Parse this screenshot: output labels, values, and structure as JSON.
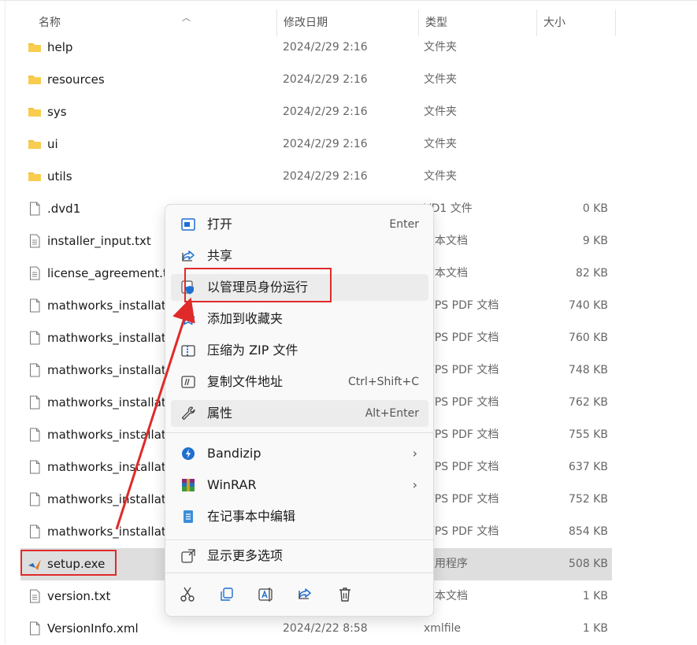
{
  "columns": {
    "name": "名称",
    "date": "修改日期",
    "type": "类型",
    "size": "大小"
  },
  "files": [
    {
      "name": "help",
      "date": "2024/2/29 2:16",
      "type": "文件夹",
      "size": "",
      "kind": "folder"
    },
    {
      "name": "resources",
      "date": "2024/2/29 2:16",
      "type": "文件夹",
      "size": "",
      "kind": "folder"
    },
    {
      "name": "sys",
      "date": "2024/2/29 2:16",
      "type": "文件夹",
      "size": "",
      "kind": "folder"
    },
    {
      "name": "ui",
      "date": "2024/2/29 2:16",
      "type": "文件夹",
      "size": "",
      "kind": "folder"
    },
    {
      "name": "utils",
      "date": "2024/2/29 2:16",
      "type": "文件夹",
      "size": "",
      "kind": "folder"
    },
    {
      "name": ".dvd1",
      "date": "",
      "type": "VD1 文件",
      "size": "0 KB",
      "kind": "file"
    },
    {
      "name": "installer_input.txt",
      "date": "",
      "type": "文本文档",
      "size": "9 KB",
      "kind": "text"
    },
    {
      "name": "license_agreement.t",
      "date": "",
      "type": "文本文档",
      "size": "82 KB",
      "kind": "text"
    },
    {
      "name": "mathworks_installati",
      "date": "",
      "type": "WPS PDF 文档",
      "size": "740 KB",
      "kind": "file"
    },
    {
      "name": "mathworks_installati",
      "date": "",
      "type": "WPS PDF 文档",
      "size": "760 KB",
      "kind": "file"
    },
    {
      "name": "mathworks_installati",
      "date": "",
      "type": "WPS PDF 文档",
      "size": "748 KB",
      "kind": "file"
    },
    {
      "name": "mathworks_installati",
      "date": "",
      "type": "WPS PDF 文档",
      "size": "762 KB",
      "kind": "file"
    },
    {
      "name": "mathworks_installati",
      "date": "",
      "type": "WPS PDF 文档",
      "size": "755 KB",
      "kind": "file"
    },
    {
      "name": "mathworks_installati",
      "date": "",
      "type": "WPS PDF 文档",
      "size": "637 KB",
      "kind": "file"
    },
    {
      "name": "mathworks_installati",
      "date": "",
      "type": "WPS PDF 文档",
      "size": "752 KB",
      "kind": "file"
    },
    {
      "name": "mathworks_installati",
      "date": "",
      "type": "WPS PDF 文档",
      "size": "854 KB",
      "kind": "file"
    },
    {
      "name": "setup.exe",
      "date": "",
      "type": "应用程序",
      "size": "508 KB",
      "kind": "matlab",
      "selected": true
    },
    {
      "name": "version.txt",
      "date": "",
      "type": "文本文档",
      "size": "1 KB",
      "kind": "text"
    },
    {
      "name": "VersionInfo.xml",
      "date": "2024/2/22 8:58",
      "type": "xmlfile",
      "size": "1 KB",
      "kind": "file"
    }
  ],
  "context_menu": {
    "items": [
      {
        "id": "open",
        "label": "打开",
        "shortcut": "Enter",
        "icon": "open-window-icon"
      },
      {
        "id": "share",
        "label": "共享",
        "shortcut": "",
        "icon": "share-icon"
      },
      {
        "id": "run-as-admin",
        "label": "以管理员身份运行",
        "shortcut": "",
        "icon": "admin-shield-icon"
      },
      {
        "id": "add-favorites",
        "label": "添加到收藏夹",
        "shortcut": "",
        "icon": "star-icon"
      },
      {
        "id": "compress-zip",
        "label": "压缩为 ZIP 文件",
        "shortcut": "",
        "icon": "zip-icon"
      },
      {
        "id": "copy-path",
        "label": "复制文件地址",
        "shortcut": "Ctrl+Shift+C",
        "icon": "copy-path-icon"
      },
      {
        "id": "properties",
        "label": "属性",
        "shortcut": "Alt+Enter",
        "icon": "wrench-icon"
      },
      {
        "id": "bandizip",
        "label": "Bandizip",
        "shortcut": "",
        "icon": "bandizip-icon",
        "submenu": true
      },
      {
        "id": "winrar",
        "label": "WinRAR",
        "shortcut": "",
        "icon": "winrar-icon",
        "submenu": true
      },
      {
        "id": "edit-notepad",
        "label": "在记事本中编辑",
        "shortcut": "",
        "icon": "notepad-icon"
      },
      {
        "id": "more-options",
        "label": "显示更多选项",
        "shortcut": "",
        "icon": "more-options-icon"
      }
    ],
    "quick_actions": [
      {
        "id": "cut",
        "icon": "cut-icon"
      },
      {
        "id": "copy",
        "icon": "copy-icon"
      },
      {
        "id": "rename",
        "icon": "rename-icon"
      },
      {
        "id": "share",
        "icon": "share-icon"
      },
      {
        "id": "delete",
        "icon": "trash-icon"
      }
    ]
  },
  "colors": {
    "highlight": "#e02a2a",
    "folder": "#f4bf3a",
    "selected_row": "#dedede",
    "accent": "#1e6fd0"
  }
}
